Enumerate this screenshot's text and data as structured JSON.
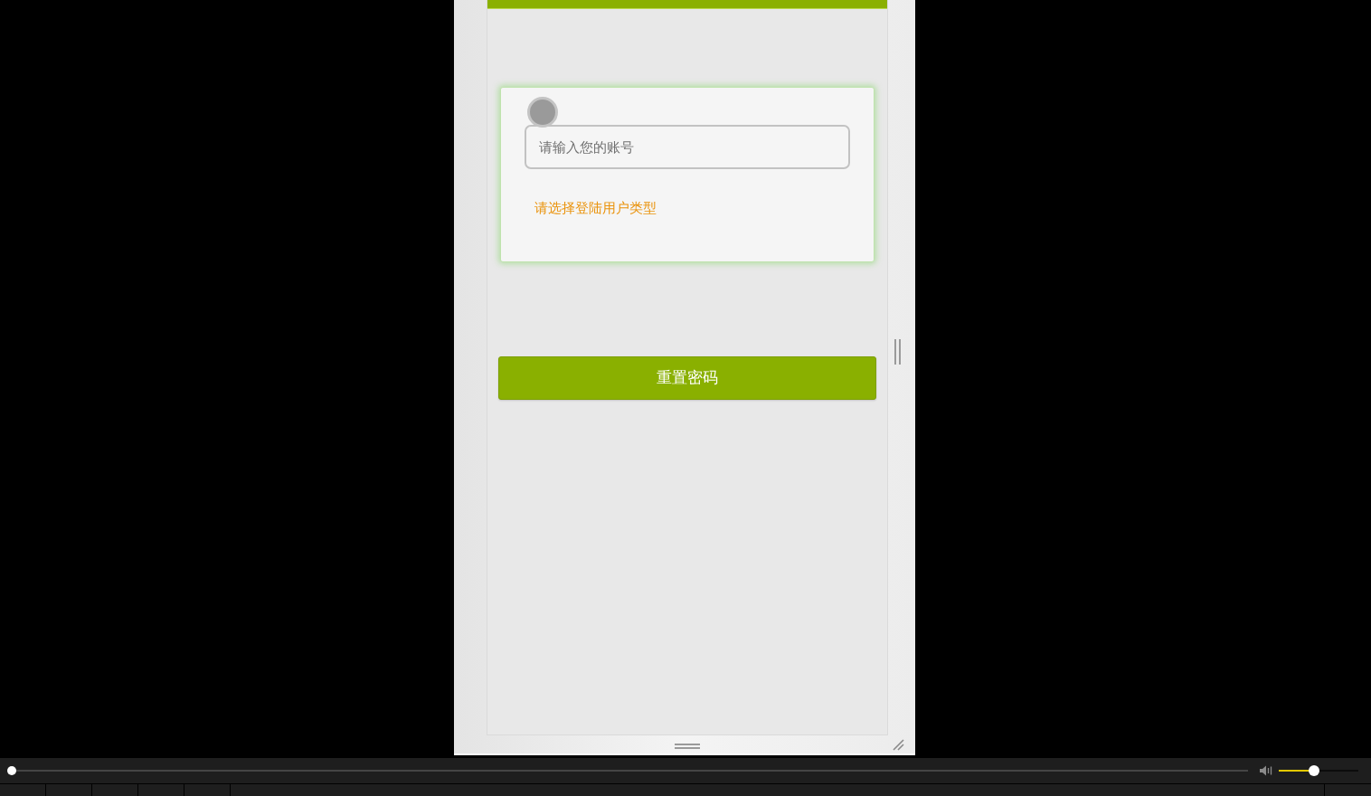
{
  "screen": {
    "account_field": {
      "placeholder": "请输入您的账号"
    },
    "user_type_prompt": "请选择登陆用户类型",
    "reset_button": "重置密码"
  },
  "player": {
    "seek": {
      "level": 0
    },
    "volume": {
      "level": 0.44
    }
  }
}
